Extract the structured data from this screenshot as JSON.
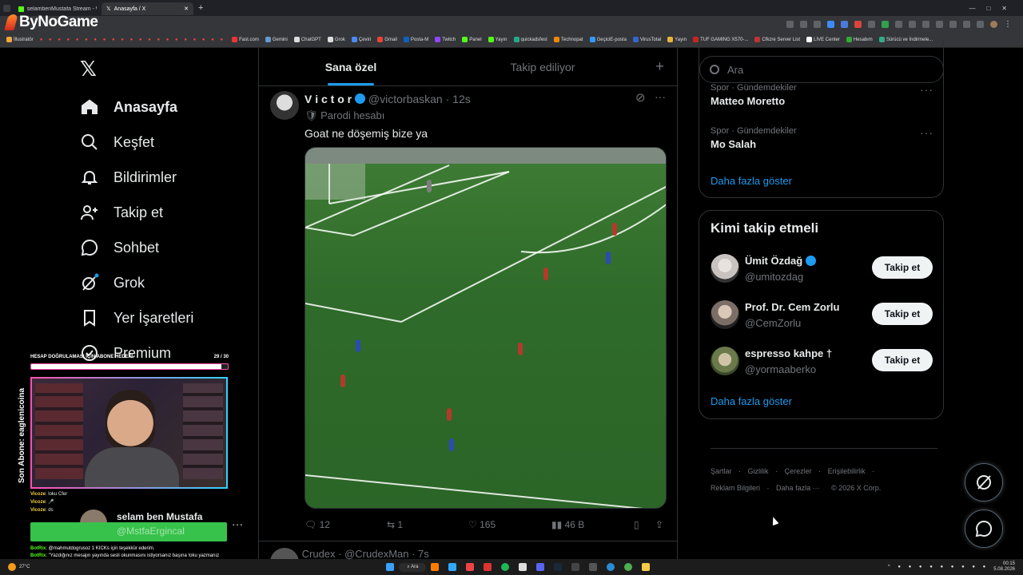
{
  "browser": {
    "tabs": [
      {
        "title": "selamben­Mustafa Stream - Wa"
      },
      {
        "title": "Anasayfa / X"
      }
    ],
    "bookmarks": [
      "İllustratör",
      "Fast.com",
      "Gemini",
      "ChatGPT",
      "Grok",
      "Çeviri",
      "Gmail",
      "Posta-M",
      "Twitch",
      "Panel",
      "Yayın",
      "quickadsfest",
      "Technopat",
      "GeçiciE-posta",
      "VirusTotal",
      "Yayın",
      "TUF GAMING X570-...",
      "Cfkzre Server List",
      "LIVE Center",
      "Hesabım",
      "Sürücü ve İndirmele..."
    ]
  },
  "overlay": {
    "logo": "ByNoGame",
    "goal_title": "HESAP DOĞRULAMASI İÇİN ABONE HEDEFİ",
    "goal_count": "29 / 30",
    "goal_progress": 0.967,
    "last_sub": "Son Abone: eaglenicoina",
    "streamer_name": "selam ben Mustafa",
    "streamer_handle": "@MstfaErgincal",
    "chat": [
      {
        "user": "Vicoze",
        "text": ": loku Cfer"
      },
      {
        "user": "Vicoze",
        "text": ": 🎤"
      },
      {
        "user": "Vicoze",
        "text": ": ds"
      },
      {
        "user": "BotRix",
        "text": ": @mahmutdogrusoz 1 KICKs için teşekkür ederim."
      },
      {
        "user": "BotRix",
        "text": ": \"Yazdığınız mesajın yayında sesli okunmasını istiyorsanız başına !oku yazmanız yeterli!\""
      }
    ]
  },
  "nav": {
    "items": [
      {
        "label": "Anasayfa",
        "icon": "home-icon"
      },
      {
        "label": "Keşfet",
        "icon": "search-icon"
      },
      {
        "label": "Bildirimler",
        "icon": "bell-icon"
      },
      {
        "label": "Takip et",
        "icon": "add-user-icon"
      },
      {
        "label": "Sohbet",
        "icon": "chat-icon"
      },
      {
        "label": "Grok",
        "icon": "grok-icon"
      },
      {
        "label": "Yer İşaretleri",
        "icon": "bookmark-icon"
      },
      {
        "label": "Premium",
        "icon": "verified-icon"
      }
    ]
  },
  "feed": {
    "tabs": [
      "Sana özel",
      "Takip ediliyor"
    ],
    "post": {
      "name": "V i c t o r",
      "handle": "@victorbaskan",
      "time": "12s",
      "parody": "Parodi hesabı",
      "text": "Goat ne döşemiş bize ya",
      "replies": "12",
      "reposts": "1",
      "likes": "165",
      "views": "46 B"
    },
    "next_post_preview": "Crudex · @CrudexMan · 7s"
  },
  "right": {
    "search_placeholder": "Ara",
    "trends": [
      {
        "category": "Spor · Gündemdekiler",
        "name": "Matteo Moretto"
      },
      {
        "category": "Spor · Gündemdekiler",
        "name": "Mo Salah"
      }
    ],
    "show_more": "Daha fazla göster",
    "who_to_follow_title": "Kimi takip etmeli",
    "suggestions": [
      {
        "name": "Ümit Özdağ",
        "handle": "@umitozdag",
        "verified": true
      },
      {
        "name": "Prof. Dr. Cem Zorlu",
        "handle": "@CemZorlu",
        "verified": false
      },
      {
        "name": "espresso kahpe †",
        "handle": "@yormaaberko",
        "verified": false
      }
    ],
    "follow_label": "Takip et",
    "footer": [
      "Şartlar",
      "Gizlilik",
      "Çerezler",
      "Erişilebilirlik",
      "Reklam Bilgileri",
      "Daha fazla ···",
      "© 2026 X Corp."
    ]
  },
  "taskbar": {
    "search": "Ara",
    "time": "00:15",
    "date": "5.08.2026",
    "weather": "27°C"
  }
}
